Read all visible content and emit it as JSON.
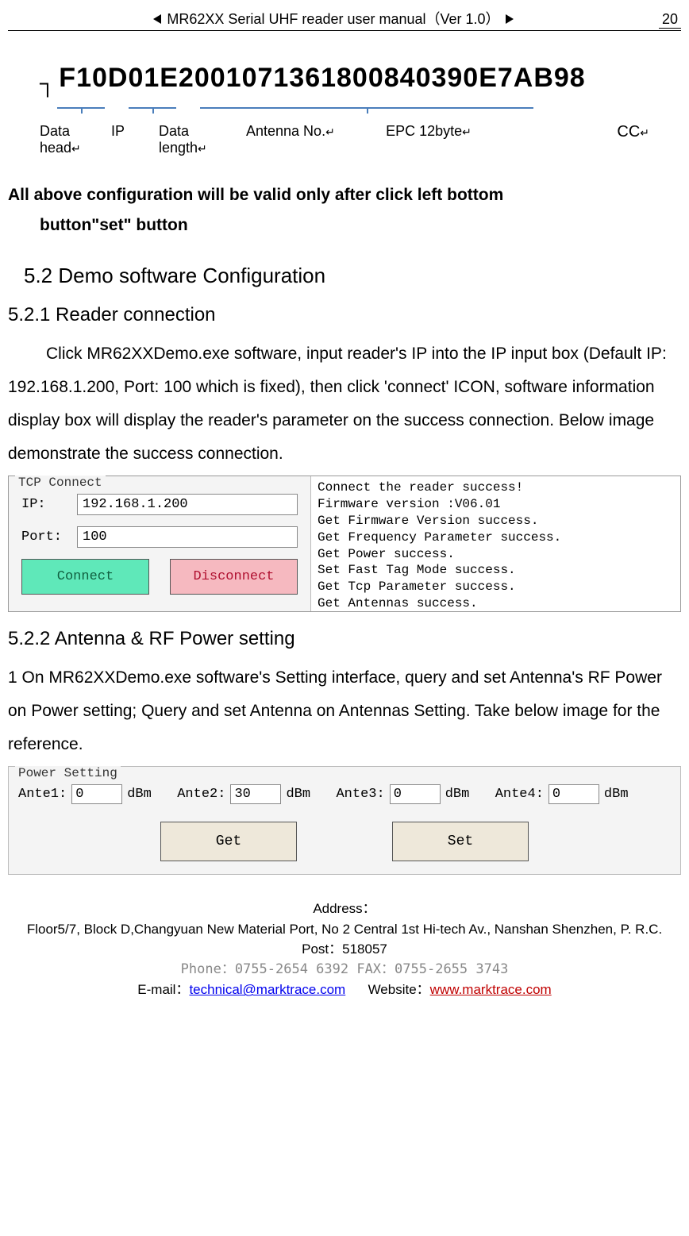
{
  "header": {
    "title": "MR62XX Serial UHF reader user manual（Ver 1.0）",
    "page_number": "20"
  },
  "epc_figure": {
    "code": "F10D01E2001071361800840390E7AB98",
    "labels": {
      "data_head": "Data head",
      "ip": "IP",
      "data_length": "Data length",
      "antenna_no": "Antenna No.",
      "epc": "EPC 12byte",
      "cc": "CC"
    }
  },
  "note": {
    "line1": "All above configuration    will be valid    only after click left bottom",
    "line2": "button\"set\" button"
  },
  "sections": {
    "s52": "5.2 Demo software Configuration",
    "s521": "5.2.1 Reader connection",
    "s521_body": "Click MR62XXDemo.exe software, input reader's IP into the IP input box (Default IP: 192.168.1.200, Port: 100 which is fixed), then click 'connect' ICON, software information display box will display the reader's parameter on the success connection. Below image demonstrate the success connection.",
    "s522": "5.2.2 Antenna & RF Power setting",
    "s522_body": "1 On MR62XXDemo.exe software's Setting interface, query and set Antenna's RF Power on Power setting; Query and set Antenna on Antennas Setting. Take below image for the reference."
  },
  "tcp_figure": {
    "group": "TCP Connect",
    "ip_label": "IP:",
    "ip_value": "192.168.1.200",
    "port_label": "Port:",
    "port_value": "100",
    "connect": "Connect",
    "disconnect": "Disconnect",
    "log": [
      "Connect the reader success!",
      "Firmware version :V06.01",
      "Get Firmware Version success.",
      "Get Frequency Parameter success.",
      "Get Power success.",
      "Set  Fast Tag Mode success.",
      "Get Tcp Parameter success.",
      "Get Antennas success."
    ]
  },
  "power_figure": {
    "group": "Power Setting",
    "ante1_label": "Ante1:",
    "ante1_val": "0",
    "ante2_label": "Ante2:",
    "ante2_val": "30",
    "ante3_label": "Ante3:",
    "ante3_val": "0",
    "ante4_label": "Ante4:",
    "ante4_val": "0",
    "unit": "dBm",
    "get": "Get",
    "set": "Set"
  },
  "footer": {
    "address_label": "Address：",
    "address": "Floor5/7, Block D,Changyuan New  Material Port, No 2 Central 1st Hi-tech Av., Nanshan Shenzhen, P. R.C.   Post：518057",
    "phone_fax": "Phone：0755-2654 6392   FAX：0755-2655 3743",
    "email_label": "E-mail：",
    "email": "technical@marktrace.com",
    "website_label": "Website：",
    "website": "www.marktrace.com"
  }
}
